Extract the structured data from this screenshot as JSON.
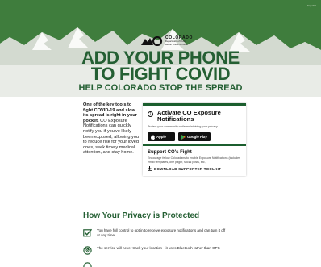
{
  "header": {
    "lang_link": "Español"
  },
  "logo": {
    "brand": "COLORADO",
    "sub1": "Department of Public",
    "sub2": "Health & Environment"
  },
  "headline": {
    "line1": "ADD YOUR PHONE",
    "line2": "TO FIGHT COVID",
    "line3": "HELP COLORADO STOP THE SPREAD"
  },
  "intro": {
    "bold": "One of the key tools to fight COVID-19 and slow its spread is right in your pocket.",
    "text": " CO Exposure Notifications can quickly notify you if you've likely been exposed, allowing you to reduce risk for your loved ones, seek timely medical attention, and stay home."
  },
  "card": {
    "title": "Activate CO Exposure Notifications",
    "desc": "Protect your community while maintaining your privacy",
    "apple_small": "Download on the",
    "apple_label": "Apple",
    "google_small": "GET IT ON",
    "google_label": "Google Play",
    "support_title": "Support CO's Fight",
    "support_desc": "Encourage fellow Coloradans to enable Exposure Notifications (includes email templates, one pager, social posts, etc.)",
    "download_label": "DOWNLOAD SUPPORTER TOOLKIT"
  },
  "privacy": {
    "title": "How Your Privacy is Protected",
    "items": [
      "You have full control to opt in to receive exposure notifications and can turn it off at any time",
      "The service will never track your location—it uses Bluetooth rather than GPS"
    ]
  },
  "colors": {
    "brand_green": "#245f33",
    "dark_green": "#1b5e2e"
  }
}
